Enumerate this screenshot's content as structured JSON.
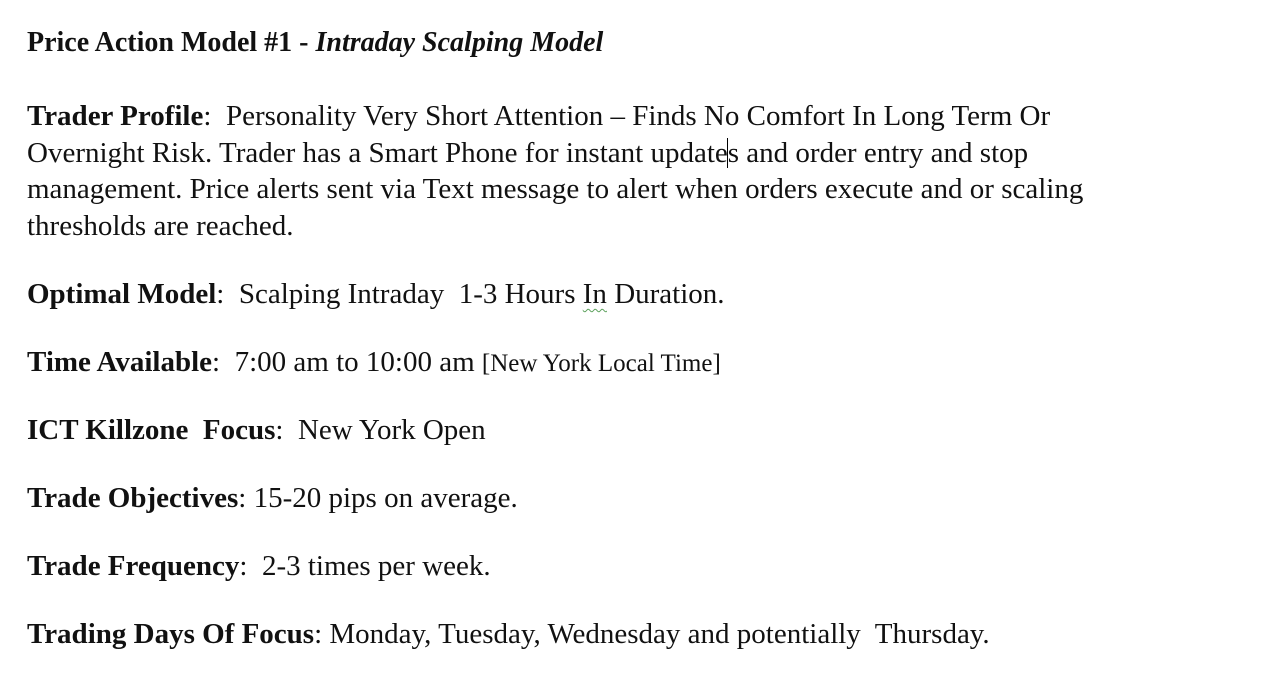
{
  "document": {
    "title": {
      "prefix": "Price Action Model #1 - ",
      "italic": "Intraday Scalping Model"
    },
    "trader_profile": {
      "label": "Trader Profile",
      "separator": ":  ",
      "lines": [
        "Personality  Very Short Attention – Finds No Comfort In Long Term Or",
        "Overnight Risk.  Trader has a Smart Phone for instant update",
        "s and order entry and stop",
        "management.  Price alerts sent via Text message to alert when orders execute and or scaling",
        "thresholds are reached."
      ]
    },
    "optimal_model": {
      "label": "Optimal Model",
      "separator": ":  ",
      "value_before": "Scalping Intraday  1-3 Hours ",
      "flagged_word": "In",
      "value_after": " Duration."
    },
    "time_available": {
      "label": "Time Available",
      "separator": ":  ",
      "value": "7:00 am to 10:00 am ",
      "note": "[New York Local Time]"
    },
    "killzone": {
      "label": "ICT Killzone  Focus",
      "separator": ":  ",
      "value": "New York Open"
    },
    "objectives": {
      "label": "Trade Objectives",
      "separator": ": ",
      "value": "15-20 pips on average."
    },
    "frequency": {
      "label": "Trade Frequency",
      "separator": ":  ",
      "value": "2-3 times per week."
    },
    "days": {
      "label": "Trading Days Of Focus",
      "separator": ": ",
      "value": "Monday, Tuesday, Wednesday and potentially  Thursday."
    }
  }
}
